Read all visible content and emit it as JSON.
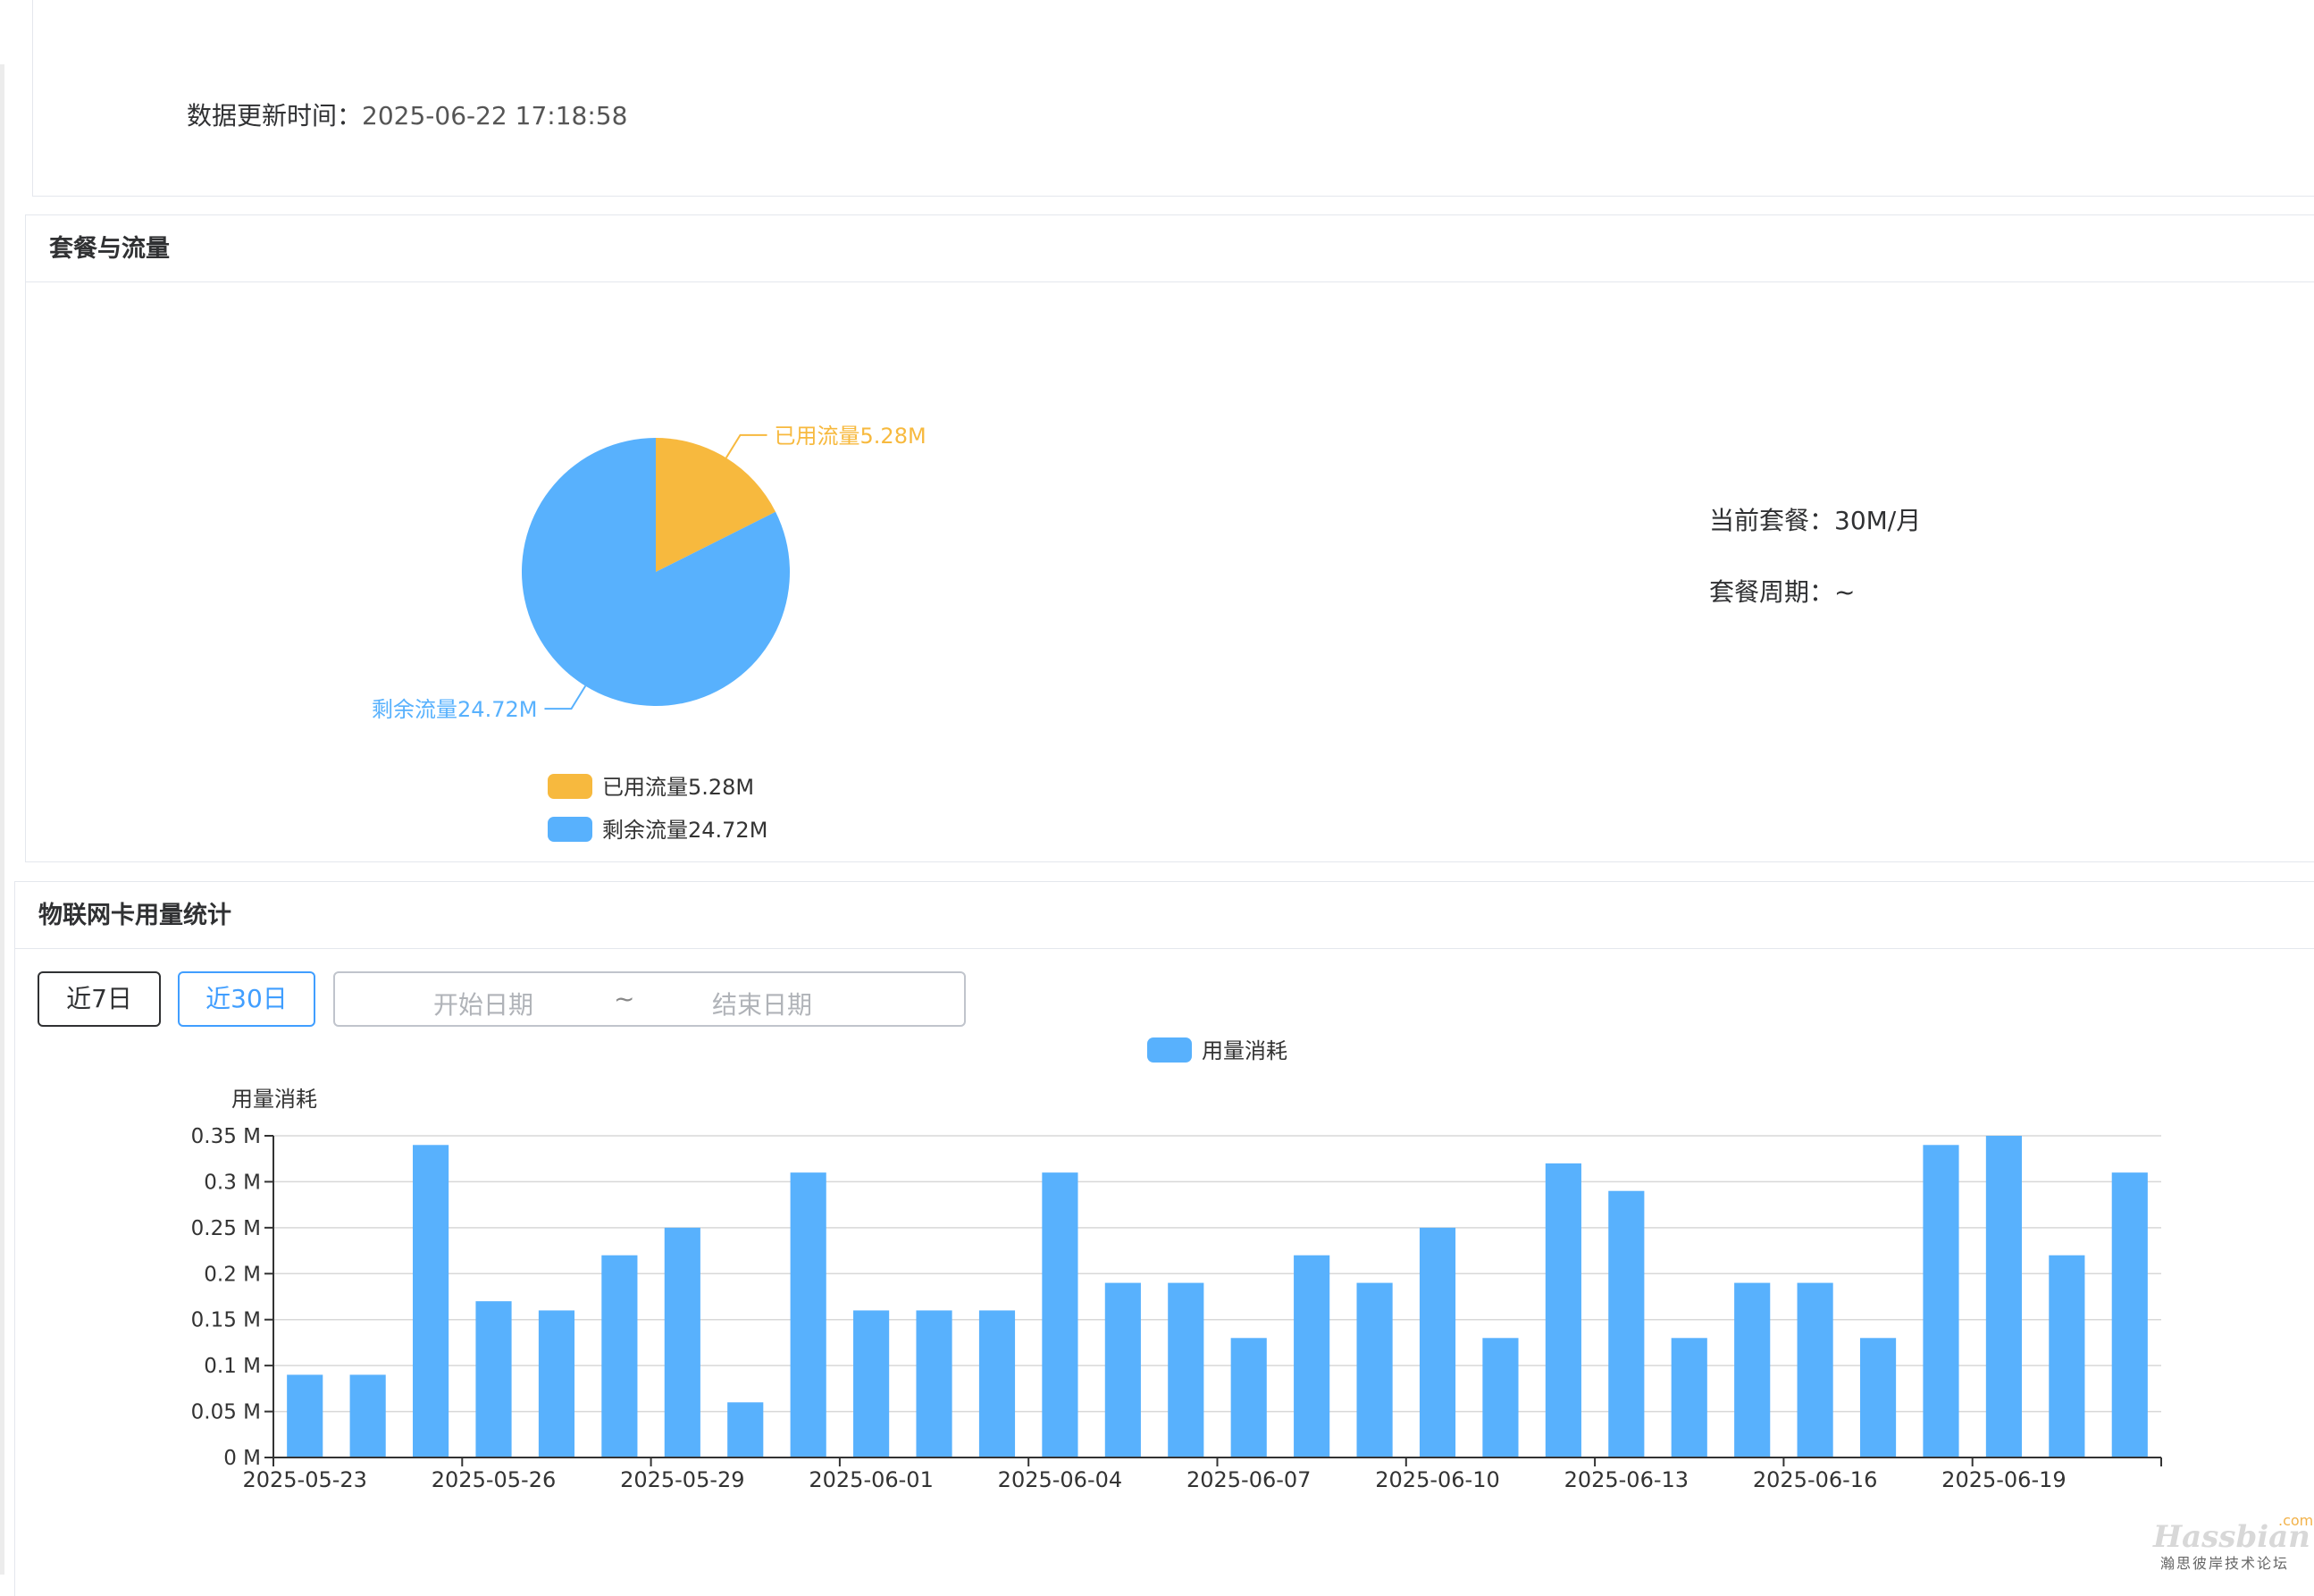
{
  "update": {
    "label": "数据更新时间：",
    "value": "2025-06-22 17:18:58"
  },
  "plan_panel": {
    "title": "套餐与流量",
    "current_plan_label": "当前套餐：",
    "current_plan_value": "30M/月",
    "cycle_label": "套餐周期：",
    "cycle_value": "~"
  },
  "usage_panel": {
    "title": "物联网卡用量统计",
    "btn_7d": "近7日",
    "btn_30d": "近30日",
    "start_placeholder": "开始日期",
    "range_sep": "~",
    "end_placeholder": "结束日期"
  },
  "chart_data": [
    {
      "type": "pie",
      "slices": [
        {
          "name": "已用流量5.28M",
          "value": 5.28,
          "color": "#f7b93e"
        },
        {
          "name": "剩余流量24.72M",
          "value": 24.72,
          "color": "#58b1fd"
        }
      ]
    },
    {
      "type": "bar",
      "series_name": "用量消耗",
      "ylabel": "用量消耗",
      "ylim": [
        0,
        0.35
      ],
      "yticks": [
        0,
        0.05,
        0.1,
        0.15,
        0.2,
        0.25,
        0.3,
        0.35
      ],
      "ytick_labels": [
        "0 M",
        "0.05 M",
        "0.1 M",
        "0.15 M",
        "0.2 M",
        "0.25 M",
        "0.3 M",
        "0.35 M"
      ],
      "color": "#58b1fd",
      "categories": [
        "2025-05-23",
        "2025-05-24",
        "2025-05-25",
        "2025-05-26",
        "2025-05-27",
        "2025-05-28",
        "2025-05-29",
        "2025-05-30",
        "2025-05-31",
        "2025-06-01",
        "2025-06-02",
        "2025-06-03",
        "2025-06-04",
        "2025-06-05",
        "2025-06-06",
        "2025-06-07",
        "2025-06-08",
        "2025-06-09",
        "2025-06-10",
        "2025-06-11",
        "2025-06-12",
        "2025-06-13",
        "2025-06-14",
        "2025-06-15",
        "2025-06-16",
        "2025-06-17",
        "2025-06-18",
        "2025-06-19",
        "2025-06-20",
        "2025-06-21"
      ],
      "values": [
        0.09,
        0.09,
        0.34,
        0.17,
        0.16,
        0.22,
        0.25,
        0.06,
        0.31,
        0.16,
        0.16,
        0.16,
        0.31,
        0.19,
        0.19,
        0.13,
        0.22,
        0.19,
        0.25,
        0.13,
        0.32,
        0.29,
        0.13,
        0.19,
        0.19,
        0.13,
        0.34,
        0.35,
        0.22,
        0.31
      ],
      "xtick_every": 3,
      "legend": "top-center"
    }
  ],
  "watermark": {
    "logo": "Hassbian",
    "dot": ".com",
    "sub": "瀚思彼岸技术论坛"
  }
}
